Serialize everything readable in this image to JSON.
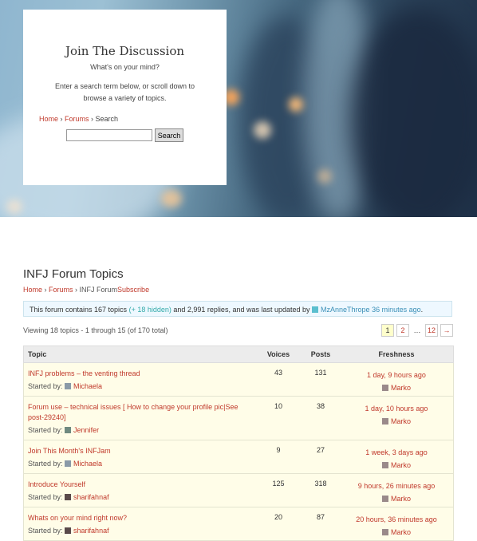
{
  "hero": {
    "title": "Join The Discussion",
    "subtitle": "What's on your mind?",
    "description": "Enter a search term below, or scroll down to browse a variety of topics.",
    "breadcrumb": {
      "home": "Home",
      "forums": "Forums",
      "current": "Search"
    },
    "search": {
      "placeholder": "",
      "button": "Search"
    }
  },
  "forum": {
    "title": "INFJ Forum Topics",
    "breadcrumb": {
      "home": "Home",
      "forums": "Forums",
      "current": "INFJ Forum",
      "subscribe": "Subscribe"
    },
    "info": {
      "prefix": "This forum contains 167 topics",
      "hidden": "(+ 18 hidden)",
      "middle": "and 2,991 replies, and was last updated by",
      "user": "MzAnneThrope",
      "time": "36 minutes ago",
      "suffix": "."
    },
    "viewing": "Viewing 18 topics - 1 through 15 (of 170 total)",
    "pager": {
      "current": "1",
      "p2": "2",
      "dots": "…",
      "last": "12",
      "next": "→"
    },
    "columns": {
      "topic": "Topic",
      "voices": "Voices",
      "posts": "Posts",
      "freshness": "Freshness"
    },
    "started_by": "Started by:",
    "topics": [
      {
        "title": "INFJ problems – the venting thread",
        "author": "Michaela",
        "voices": "43",
        "posts": "131",
        "freshness": "1 day, 9 hours ago",
        "last_user": "Marko"
      },
      {
        "title": "Forum use – technical issues [ How to change your profile pic|See post-29240]",
        "author": "Jennifer",
        "voices": "10",
        "posts": "38",
        "freshness": "1 day, 10 hours ago",
        "last_user": "Marko"
      },
      {
        "title": "Join This Month's INFJam",
        "author": "Michaela",
        "voices": "9",
        "posts": "27",
        "freshness": "1 week, 3 days ago",
        "last_user": "Marko"
      },
      {
        "title": "Introduce Yourself",
        "author": "sharifahnaf",
        "voices": "125",
        "posts": "318",
        "freshness": "9 hours, 26 minutes ago",
        "last_user": "Marko"
      },
      {
        "title": "Whats on your mind right now?",
        "author": "sharifahnaf",
        "voices": "20",
        "posts": "87",
        "freshness": "20 hours, 36 minutes ago",
        "last_user": "Marko"
      }
    ]
  },
  "colors": {
    "link": "#c0392b",
    "row_bg": "#fffde8",
    "info_bg": "#eef8ff"
  }
}
